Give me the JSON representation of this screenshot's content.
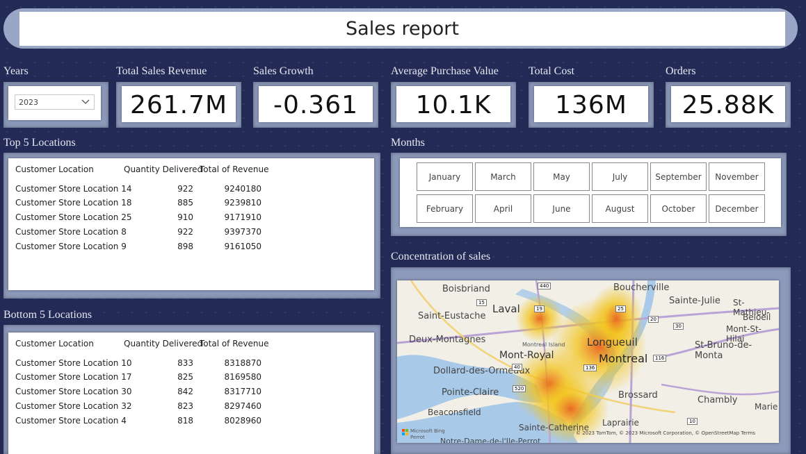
{
  "header": {
    "title": "Sales report"
  },
  "filters": {
    "years_label": "Years",
    "year_value": "2023"
  },
  "kpis": [
    {
      "label": "Total Sales Revenue",
      "value": "261.7M"
    },
    {
      "label": "Sales Growth",
      "value": "-0.361"
    },
    {
      "label": "Average Purchase Value",
      "value": "10.1K"
    },
    {
      "label": "Total Cost",
      "value": "136M"
    },
    {
      "label": "Orders",
      "value": "25.88K"
    }
  ],
  "top5": {
    "title": "Top 5 Locations",
    "columns": [
      "Customer Location",
      "Quantity Delivered",
      "Total of Revenue"
    ],
    "rows": [
      [
        "Customer Store Location 14",
        "922",
        "9240180"
      ],
      [
        "Customer Store Location 18",
        "885",
        "9239810"
      ],
      [
        "Customer Store Location 25",
        "910",
        "9171910"
      ],
      [
        "Customer Store Location 8",
        "922",
        "9397370"
      ],
      [
        "Customer Store Location 9",
        "898",
        "9161050"
      ]
    ]
  },
  "bottom5": {
    "title": "Bottom 5 Locations",
    "columns": [
      "Customer Location",
      "Quantity Delivered",
      "Total of Revenue"
    ],
    "rows": [
      [
        "Customer Store Location 10",
        "833",
        "8318870"
      ],
      [
        "Customer Store Location 17",
        "825",
        "8169580"
      ],
      [
        "Customer Store Location 30",
        "842",
        "8317710"
      ],
      [
        "Customer Store Location 32",
        "823",
        "8297460"
      ],
      [
        "Customer Store Location 4",
        "818",
        "8028960"
      ]
    ]
  },
  "months": {
    "title": "Months",
    "row1": [
      "January",
      "March",
      "May",
      "July",
      "September",
      "November"
    ],
    "row2": [
      "February",
      "April",
      "June",
      "August",
      "October",
      "December"
    ]
  },
  "map": {
    "title": "Concentration of sales",
    "places": {
      "boisbriand": "Boisbriand",
      "boucherville": "Boucherville",
      "laval": "Laval",
      "sainte_julie": "Sainte-Julie",
      "st_mathieu": "St-Mathieu-",
      "beloeil": "Beloeil",
      "saint_eustache": "Saint-Eustache",
      "mont_st_hilaire": "Mont-St-Hilai",
      "deux_montagnes": "Deux-Montagnes",
      "montreal_island": "Montreal Island",
      "longueuil": "Longueuil",
      "st_bruno": "St-Bruno-de-Monta",
      "mont_royal": "Mont-Royal",
      "montreal": "Montreal",
      "dollard": "Dollard-des-Ormeaux",
      "pointe_claire": "Pointe-Claire",
      "brossard": "Brossard",
      "chambly": "Chambly",
      "beaconsfield": "Beaconsfield",
      "marie": "Marie",
      "laprairie": "Laprairie",
      "sainte_catherine": "Sainte-Catherine",
      "notre_dame": "Notre-Dame-de-l'Ile-Perrot"
    },
    "shields": [
      "440",
      "15",
      "19",
      "25",
      "20",
      "30",
      "40",
      "136",
      "116",
      "520",
      "10"
    ],
    "attribution": "© 2023 TomTom, © 2023 Microsoft Corporation, © OpenStreetMap  Terms",
    "brand": "Microsoft Bing",
    "brand_sub": "Perrot"
  },
  "colors": {
    "background": "#232a55",
    "frame": "#8d9abb",
    "heat_hot": "#e8641e",
    "heat_mid": "#f2c419"
  }
}
